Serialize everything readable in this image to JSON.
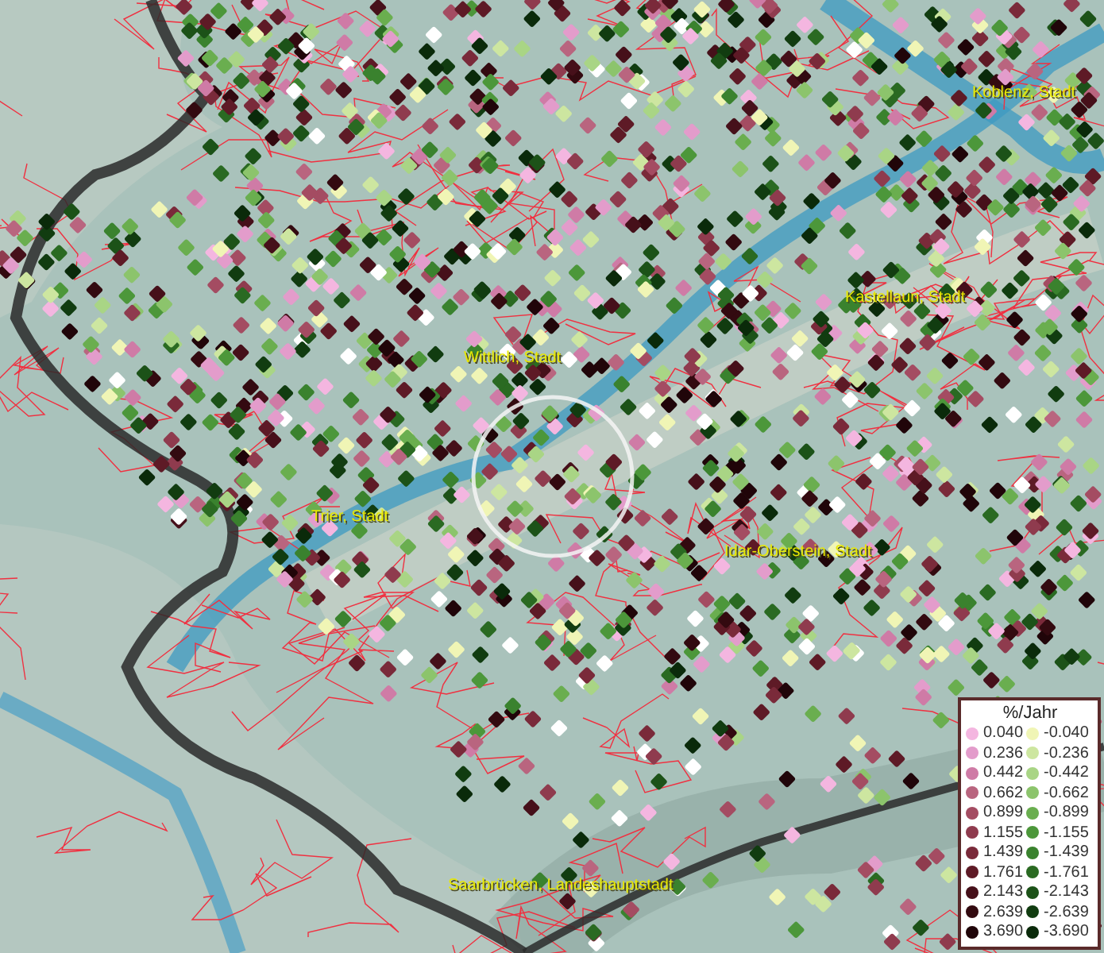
{
  "map": {
    "places": [
      {
        "name": "Koblenz, Stadt"
      },
      {
        "name": "Kastellaun, Stadt"
      },
      {
        "name": "Wittlich, Stadt"
      },
      {
        "name": "Trier, Stadt"
      },
      {
        "name": "Idar-Oberstein, Stadt"
      },
      {
        "name": "Saarbrücken, Landeshauptstadt"
      }
    ]
  },
  "legend": {
    "title": "%/Jahr",
    "positive": [
      {
        "value": "0.040",
        "color": "#f4b6e0"
      },
      {
        "value": "0.236",
        "color": "#e39ccb"
      },
      {
        "value": "0.442",
        "color": "#cf7ba6"
      },
      {
        "value": "0.662",
        "color": "#b9657f"
      },
      {
        "value": "0.899",
        "color": "#a44c62"
      },
      {
        "value": "1.155",
        "color": "#8f3b4e"
      },
      {
        "value": "1.439",
        "color": "#7a2a3a"
      },
      {
        "value": "1.761",
        "color": "#5e1a26"
      },
      {
        "value": "2.143",
        "color": "#46101a"
      },
      {
        "value": "2.639",
        "color": "#330a10"
      },
      {
        "value": "3.690",
        "color": "#200509"
      }
    ],
    "negative": [
      {
        "value": "-0.040",
        "color": "#f0f5b5"
      },
      {
        "value": "-0.236",
        "color": "#cde6a0"
      },
      {
        "value": "-0.442",
        "color": "#a9d585"
      },
      {
        "value": "-0.662",
        "color": "#8cc46c"
      },
      {
        "value": "-0.899",
        "color": "#6aae4f"
      },
      {
        "value": "-1.155",
        "color": "#4c973a"
      },
      {
        "value": "-1.439",
        "color": "#3a822e"
      },
      {
        "value": "-1.761",
        "color": "#2a6a22"
      },
      {
        "value": "-2.143",
        "color": "#1c5218"
      },
      {
        "value": "-2.639",
        "color": "#113c10"
      },
      {
        "value": "-3.690",
        "color": "#0a2a0a"
      }
    ]
  }
}
